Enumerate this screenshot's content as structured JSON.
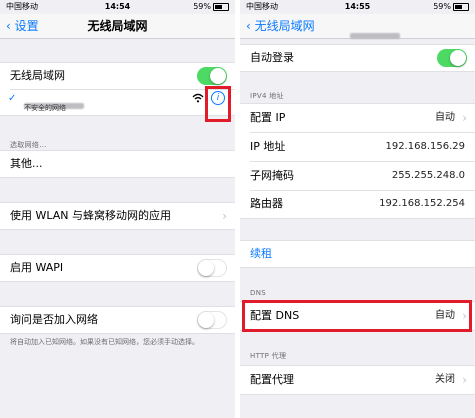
{
  "left": {
    "status": {
      "carrier": "中国移动",
      "time": "14:54",
      "battery": "59%"
    },
    "nav": {
      "back": "设置",
      "title": "无线局域网"
    },
    "wlan": {
      "label": "无线局域网"
    },
    "network": {
      "subtitle": "不安全的网络",
      "info_glyph": "i"
    },
    "choose_header": "选取网络...",
    "other": "其他...",
    "apps_wlan": "使用 WLAN 与蜂窝移动网的应用",
    "wapi": "启用 WAPI",
    "ask_join": "询问是否加入网络",
    "footnote": "将自动加入已知网络。如果没有已知网络，您必须手动选择。"
  },
  "right": {
    "status": {
      "carrier": "中国移动",
      "time": "14:55",
      "battery": "59%"
    },
    "nav": {
      "back": "无线局域网"
    },
    "auto_login": "自动登录",
    "ipv4_header": "IPV4 地址",
    "rows": [
      {
        "label": "配置 IP",
        "value": "自动"
      },
      {
        "label": "IP 地址",
        "value": "192.168.156.29"
      },
      {
        "label": "子网掩码",
        "value": "255.255.248.0"
      },
      {
        "label": "路由器",
        "value": "192.168.152.254"
      }
    ],
    "renew": "续租",
    "dns_header": "DNS",
    "dns": {
      "label": "配置 DNS",
      "value": "自动"
    },
    "http_header": "HTTP 代理",
    "proxy": {
      "label": "配置代理",
      "value": "关闭"
    }
  },
  "colors": {
    "accent": "#0a7aff",
    "toggle_on": "#4cd964",
    "highlight": "#e21b2a"
  }
}
